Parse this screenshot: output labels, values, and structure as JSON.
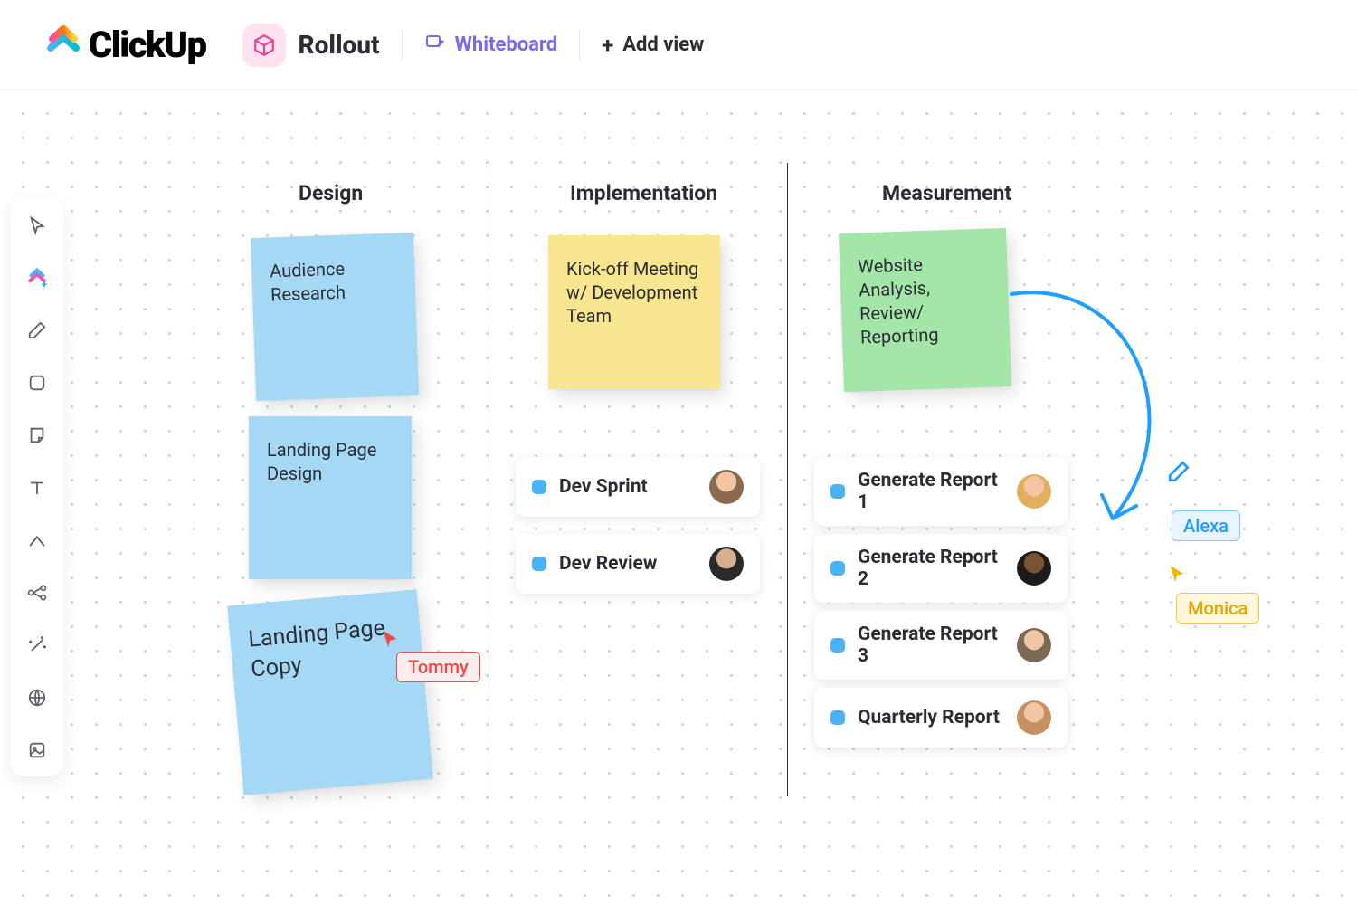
{
  "header": {
    "app_name": "ClickUp",
    "view_title": "Rollout",
    "whiteboard_label": "Whiteboard",
    "add_view_label": "Add view"
  },
  "toolbar": {
    "items": [
      "pointer",
      "clickup",
      "pen",
      "square",
      "sticky-note",
      "text",
      "connector",
      "relationship",
      "ai-magic",
      "web",
      "image"
    ]
  },
  "board": {
    "columns": [
      {
        "heading": "Design"
      },
      {
        "heading": "Implementation"
      },
      {
        "heading": "Measurement"
      }
    ],
    "stickies": {
      "design_1": "Audience Research",
      "design_2": "Landing Page Design",
      "design_3": "Landing Page Copy",
      "impl_1": "Kick-off Meeting w/ Development Team",
      "meas_1": "Website Analysis, Review/ Reporting"
    },
    "tasks": {
      "impl": [
        {
          "title": "Dev Sprint"
        },
        {
          "title": "Dev Review"
        }
      ],
      "meas": [
        {
          "title": "Generate Report 1"
        },
        {
          "title": "Generate Report 2"
        },
        {
          "title": "Generate Report 3"
        },
        {
          "title": "Quarterly Report"
        }
      ]
    },
    "cursors": {
      "tommy": "Tommy",
      "alexa": "Alexa",
      "monica": "Monica"
    }
  },
  "colors": {
    "accent_purple": "#7b68ee",
    "sticky_blue": "#a4d8f5",
    "sticky_yellow": "#f8e58f",
    "sticky_green": "#a4e5a8",
    "task_status": "#49b3f6",
    "arrow_blue": "#1f9efd"
  }
}
